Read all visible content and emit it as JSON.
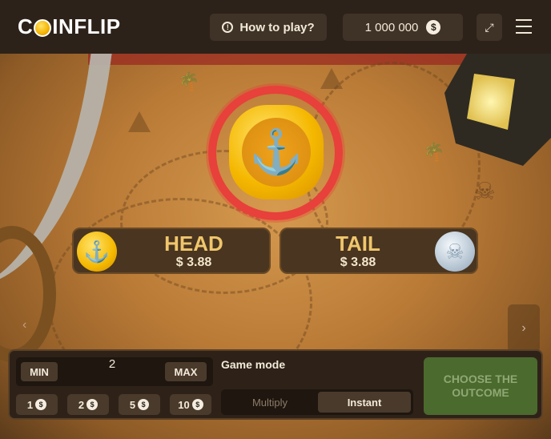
{
  "header": {
    "logo_text": "COINFLIP",
    "how_to_play_label": "How to play?",
    "balance": "1 000 000",
    "currency_symbol": "$"
  },
  "game": {
    "options": [
      {
        "label": "HEAD",
        "payout": "$ 3.88"
      },
      {
        "label": "TAIL",
        "payout": "$ 3.88"
      }
    ]
  },
  "controls": {
    "min_label": "MIN",
    "max_label": "MAX",
    "bet_amount": "2",
    "chips": [
      "1",
      "2",
      "5",
      "10"
    ],
    "game_mode_title": "Game mode",
    "modes": [
      "Multiply",
      "Instant"
    ],
    "selected_mode": "Instant",
    "choose_button_label": "CHOOSE THE OUTCOME"
  },
  "colors": {
    "accent_gold": "#f0c66c",
    "ring_red": "#e8403a",
    "choose_green": "#4b6a2e"
  }
}
